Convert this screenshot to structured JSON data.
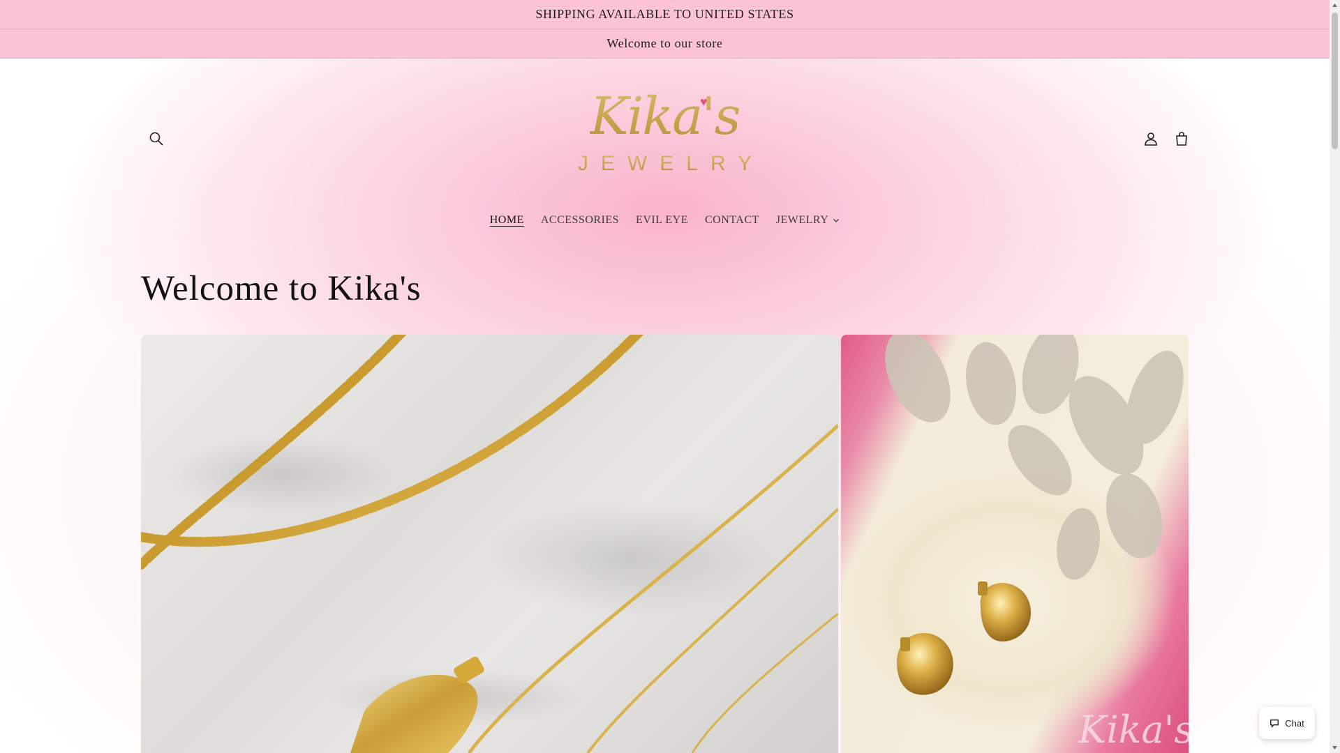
{
  "announcements": {
    "shipping": "SHIPPING AVAILABLE TO UNITED STATES",
    "welcome": "Welcome to our store"
  },
  "header": {
    "logo_script": "Kika's",
    "logo_sub": "JEWELRY",
    "icons": {
      "search": "search-icon",
      "account": "user-icon",
      "cart": "bag-icon"
    }
  },
  "nav": {
    "items": [
      {
        "label": "HOME",
        "active": true
      },
      {
        "label": "ACCESSORIES"
      },
      {
        "label": "EVIL EYE"
      },
      {
        "label": "CONTACT"
      },
      {
        "label": "JEWELRY",
        "dropdown": true
      }
    ]
  },
  "main": {
    "title": "Welcome to Kika's"
  },
  "chat": {
    "label": "Chat"
  },
  "colors": {
    "announcement_bg": "#fbc3d3",
    "gold": "#c7a44d",
    "pink_accent": "#e2557e"
  }
}
